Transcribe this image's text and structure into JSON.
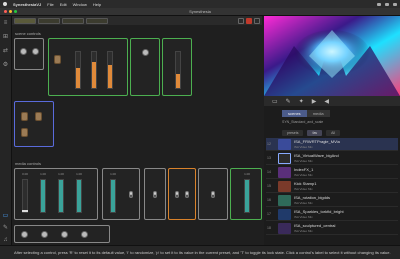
{
  "menubar": {
    "app": "SynesthesiaVJ",
    "items": [
      "File",
      "Edit",
      "Window",
      "Help"
    ]
  },
  "window": {
    "title": "Synesthesia"
  },
  "sections": {
    "scene_controls": "scene controls",
    "media_controls": "media controls"
  },
  "panels": {
    "p1": "",
    "p2": "",
    "p3": "",
    "p4": "",
    "p5": ""
  },
  "scene_faders": [
    {
      "value": 0.56,
      "label": ""
    },
    {
      "value": 0.72,
      "label": ""
    },
    {
      "value": 0.65,
      "label": ""
    },
    {
      "value": 0.4,
      "label": ""
    }
  ],
  "media_values": [
    "0.00",
    "1.00",
    "1.00",
    "1.00",
    "1.00",
    "0.00",
    "1.00"
  ],
  "library": {
    "tabs": [
      "scenes",
      "media"
    ],
    "active_tab": "scenes",
    "breadcrumb": "SYN_Standard_and_scale",
    "filters": [
      "presets",
      "fav",
      "All"
    ],
    "items": [
      {
        "name": "ISA_FRWRTPragle_MVia",
        "sub": "ISA Video Mix",
        "color": "#3a4b9a"
      },
      {
        "name": "ISA_VirtualWave_bigAnd",
        "sub": "ISA Video Mix",
        "color": "#2b2b2b"
      },
      {
        "name": "IndexFX_1",
        "sub": "ISA Video Mix",
        "color": "#5a2f7a"
      },
      {
        "name": "Kick Stamp1",
        "sub": "ISA Video Mix",
        "color": "#7a3a2a"
      },
      {
        "name": "ISA_rotation_bigdds",
        "sub": "ISA Video Mix",
        "color": "#2f6a5a"
      },
      {
        "name": "ISA_Sparkles_torkfid_bright",
        "sub": "ISA Video Mix",
        "color": "#203a6a"
      },
      {
        "name": "ISA_sculptured_central",
        "sub": "ISA Video Mix",
        "color": "#3a2a5a"
      }
    ]
  },
  "statusbar": {
    "text": "After selecting a control, press 'R' to reset it to its default value, 'I' to randomize, 'p' to set it to its value in the current preset, and 'T' to toggle its lock state. Click a control's label to select it without changing its value."
  },
  "colors": {
    "accent_orange": "#e08a3a",
    "accent_teal": "#3aa39a",
    "panel_green": "#4caf50",
    "panel_blue": "#5a6bdc"
  }
}
